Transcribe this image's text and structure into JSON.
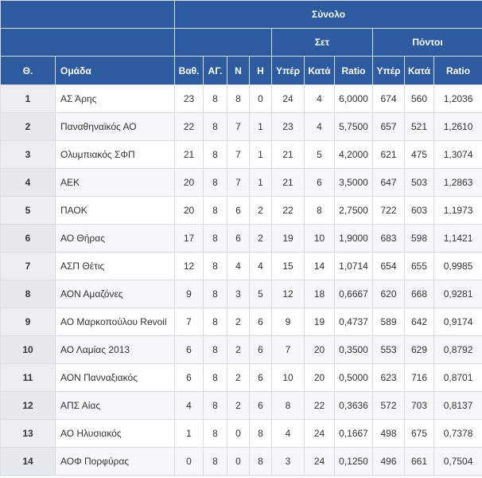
{
  "header": {
    "group_total": "Σύνολο",
    "group_sets": "Σετ",
    "group_points": "Πόντοι",
    "columns": [
      "Θ.",
      "Ομάδα",
      "Βαθ.",
      "ΑΓ.",
      "Ν",
      "Η",
      "Υπέρ",
      "Κατά",
      "Ratio",
      "Υπέρ",
      "Κατά",
      "Ratio"
    ]
  },
  "rows": [
    {
      "pos": "1",
      "team": "ΑΣ Άρης",
      "pts": "23",
      "mp": "8",
      "w": "8",
      "l": "0",
      "sf": "24",
      "sa": "4",
      "sr": "6,0000",
      "pf": "674",
      "pa": "560",
      "pr": "1,2036"
    },
    {
      "pos": "2",
      "team": "Παναθηναϊκός ΑΟ",
      "pts": "22",
      "mp": "8",
      "w": "7",
      "l": "1",
      "sf": "23",
      "sa": "4",
      "sr": "5,7500",
      "pf": "657",
      "pa": "521",
      "pr": "1,2610"
    },
    {
      "pos": "3",
      "team": "Ολυμπιακός ΣΦΠ",
      "pts": "21",
      "mp": "8",
      "w": "7",
      "l": "1",
      "sf": "21",
      "sa": "5",
      "sr": "4,2000",
      "pf": "621",
      "pa": "475",
      "pr": "1,3074"
    },
    {
      "pos": "4",
      "team": "ΑΕΚ",
      "pts": "20",
      "mp": "8",
      "w": "7",
      "l": "1",
      "sf": "21",
      "sa": "6",
      "sr": "3,5000",
      "pf": "647",
      "pa": "503",
      "pr": "1,2863"
    },
    {
      "pos": "5",
      "team": "ΠΑΟΚ",
      "pts": "20",
      "mp": "8",
      "w": "6",
      "l": "2",
      "sf": "22",
      "sa": "8",
      "sr": "2,7500",
      "pf": "722",
      "pa": "603",
      "pr": "1,1973"
    },
    {
      "pos": "6",
      "team": "ΑΟ Θήρας",
      "pts": "17",
      "mp": "8",
      "w": "6",
      "l": "2",
      "sf": "19",
      "sa": "10",
      "sr": "1,9000",
      "pf": "683",
      "pa": "598",
      "pr": "1,1421"
    },
    {
      "pos": "7",
      "team": "ΑΣΠ Θέτις",
      "pts": "12",
      "mp": "8",
      "w": "4",
      "l": "4",
      "sf": "15",
      "sa": "14",
      "sr": "1,0714",
      "pf": "654",
      "pa": "655",
      "pr": "0,9985"
    },
    {
      "pos": "8",
      "team": "ΑΟΝ Αμαζόνες",
      "pts": "9",
      "mp": "8",
      "w": "3",
      "l": "5",
      "sf": "12",
      "sa": "18",
      "sr": "0,6667",
      "pf": "620",
      "pa": "668",
      "pr": "0,9281"
    },
    {
      "pos": "9",
      "team": "ΑΟ Μαρκοπούλου Revoil",
      "pts": "7",
      "mp": "8",
      "w": "2",
      "l": "6",
      "sf": "9",
      "sa": "19",
      "sr": "0,4737",
      "pf": "589",
      "pa": "642",
      "pr": "0,9174"
    },
    {
      "pos": "10",
      "team": "ΑΟ Λαμίας 2013",
      "pts": "6",
      "mp": "8",
      "w": "2",
      "l": "6",
      "sf": "7",
      "sa": "20",
      "sr": "0,3500",
      "pf": "553",
      "pa": "629",
      "pr": "0,8792"
    },
    {
      "pos": "11",
      "team": "ΑΟΝ Πανναξιακός",
      "pts": "6",
      "mp": "8",
      "w": "2",
      "l": "6",
      "sf": "10",
      "sa": "20",
      "sr": "0,5000",
      "pf": "623",
      "pa": "716",
      "pr": "0,8701"
    },
    {
      "pos": "12",
      "team": "ΑΠΣ Αίας",
      "pts": "4",
      "mp": "8",
      "w": "2",
      "l": "6",
      "sf": "8",
      "sa": "22",
      "sr": "0,3636",
      "pf": "572",
      "pa": "703",
      "pr": "0,8137"
    },
    {
      "pos": "13",
      "team": "ΑΟ Ηλυσιακός",
      "pts": "1",
      "mp": "8",
      "w": "0",
      "l": "8",
      "sf": "4",
      "sa": "24",
      "sr": "0,1667",
      "pf": "498",
      "pa": "675",
      "pr": "0,7378"
    },
    {
      "pos": "14",
      "team": "ΑΟΦ Πορφύρας",
      "pts": "0",
      "mp": "8",
      "w": "0",
      "l": "8",
      "sf": "3",
      "sa": "24",
      "sr": "0,1250",
      "pf": "496",
      "pa": "661",
      "pr": "0,7504"
    }
  ]
}
